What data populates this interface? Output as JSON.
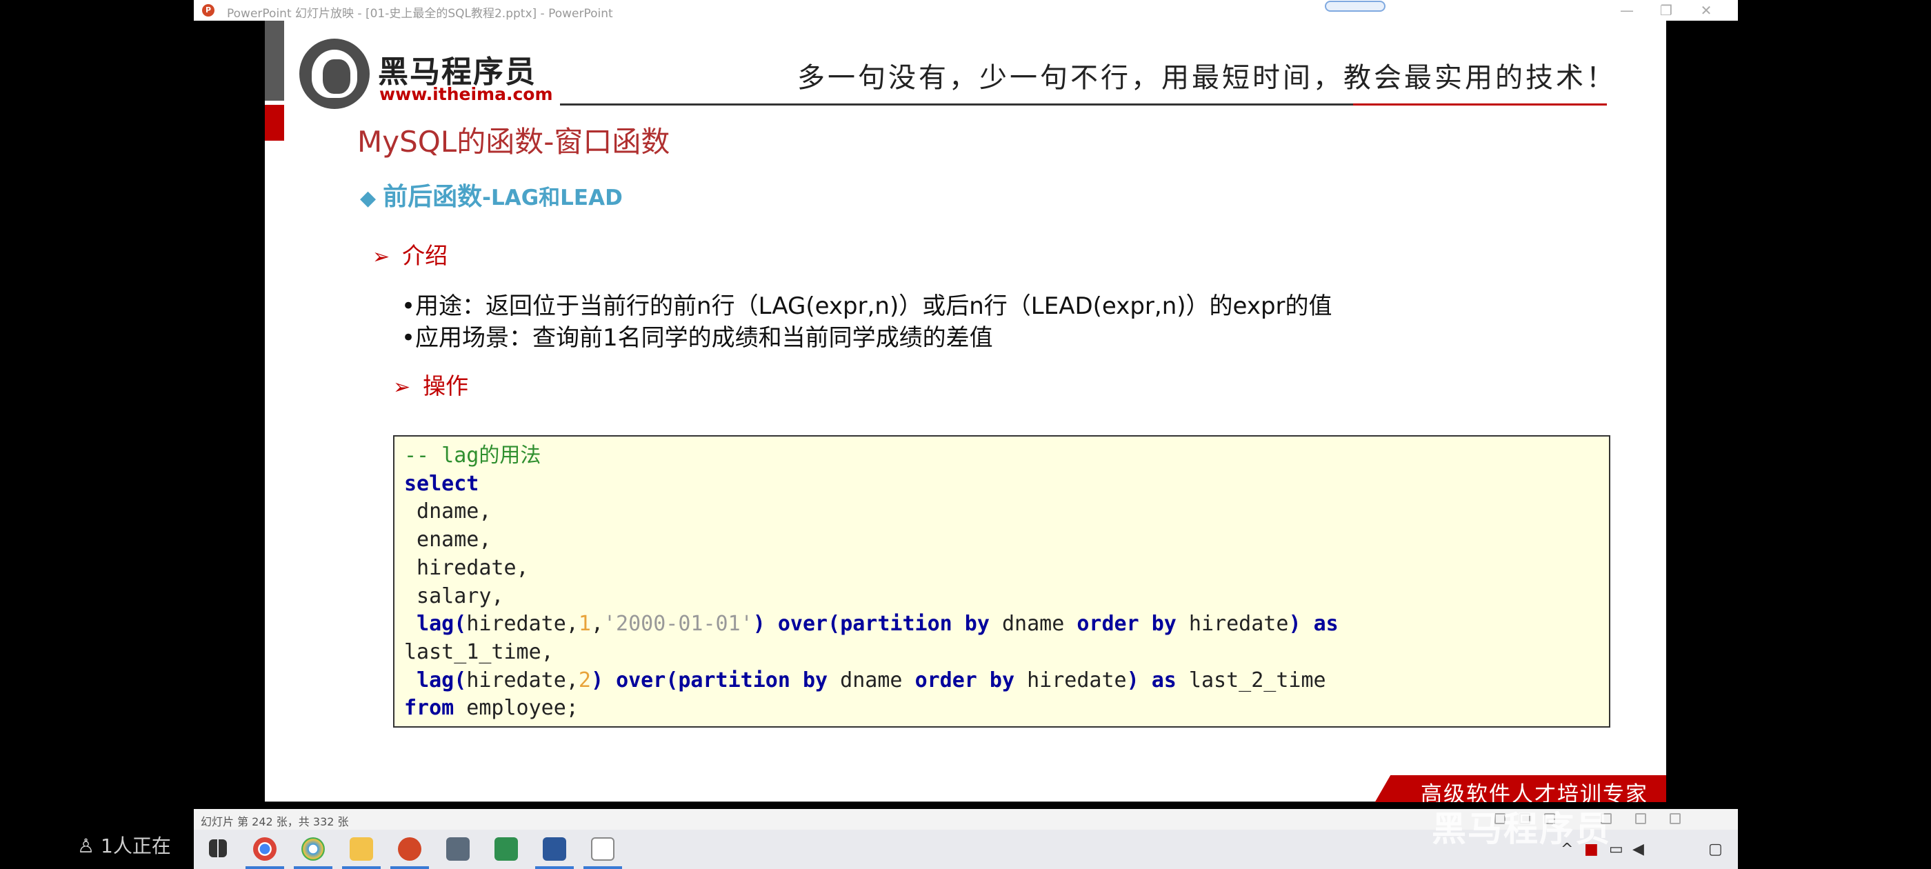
{
  "window": {
    "title": "PowerPoint 幻灯片放映 - [01-史上最全的SQL教程2.pptx] - PowerPoint",
    "minimize": "—",
    "restore": "❐",
    "close": "✕"
  },
  "header": {
    "logo_name": "黑马程序员",
    "logo_url": "www.itheima.com",
    "slogan": "多一句没有，少一句不行，用最短时间，教会最实用的技术！"
  },
  "slide": {
    "title": "MySQL的函数-窗口函数",
    "section_cn": "前后函数",
    "section_en": "-LAG和LEAD",
    "intro_heading": "介绍",
    "bullets": [
      "•用途：返回位于当前行的前n行（LAG(expr,n)）或后n行（LEAD(expr,n)）的expr的值",
      "•应用场景：查询前1名同学的成绩和当前同学成绩的差值"
    ],
    "ops_heading": "操作",
    "code": {
      "comment": "-- lag的用法",
      "kw_select": "select",
      "col_dname": " dname,",
      "col_ename": " ename,",
      "col_hiredate": " hiredate,",
      "col_salary": " salary,",
      "kw_lag": "lag",
      "kw_over": "over",
      "kw_partition_by": "partition by",
      "kw_order_by": "order by",
      "kw_as": "as",
      "kw_from": "from",
      "arg_hiredate": "hiredate,",
      "num_1": "1",
      "num_2": "2",
      "str_default": "'2000-01-01'",
      "dname": " dname ",
      "hiredate": " hiredate",
      "alias1": "last_1_time,",
      "alias2": " last_2_time",
      "from_rest": " employee;"
    },
    "footer": "高级软件人才培训专家"
  },
  "statusbar": {
    "slide_count": "幻灯片 第 242 张，共 332 张"
  },
  "stream": {
    "viewers": "1人正在",
    "watermark": "黑马程序员"
  },
  "colors": {
    "brand_red": "#c00000",
    "section_blue": "#4aa3c8",
    "code_bg": "#ffffe1",
    "keyword": "#00009c"
  }
}
